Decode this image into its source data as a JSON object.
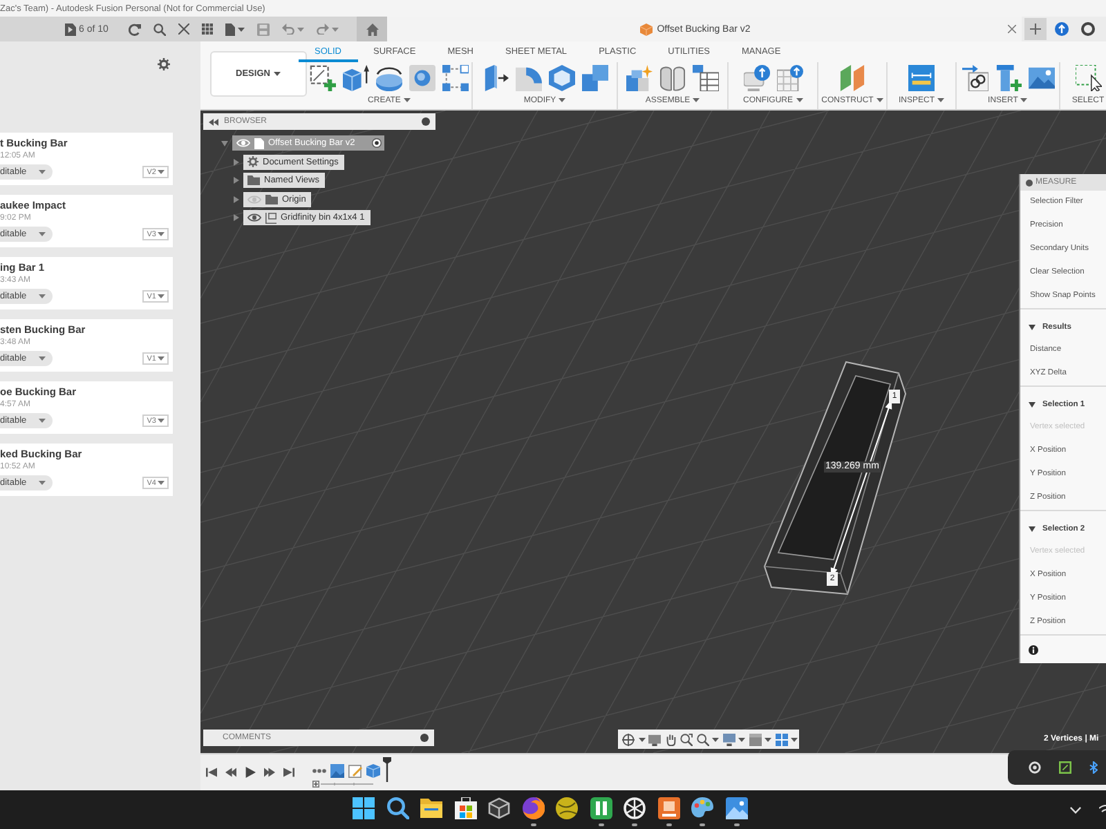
{
  "title_bar": {
    "title": "Zac's Team) - Autodesk Fusion Personal (Not for Commercial Use)"
  },
  "quick_toolbar": {
    "counter": "6 of 10"
  },
  "document_tabs": [
    {
      "label": "Offset Bucking Bar v2",
      "selected": true
    }
  ],
  "data_panel": {
    "files": [
      {
        "name": "t Bucking Bar",
        "time": "12:05 AM",
        "access": "ditable",
        "version": "V2"
      },
      {
        "name": "aukee Impact",
        "time": "9:02 PM",
        "access": "ditable",
        "version": "V3"
      },
      {
        "name": "ing Bar 1",
        "time": "3:43 AM",
        "access": "ditable",
        "version": "V1"
      },
      {
        "name": "sten Bucking Bar",
        "time": "3:48 AM",
        "access": "ditable",
        "version": "V1"
      },
      {
        "name": "oe Bucking Bar",
        "time": "4:57 AM",
        "access": "ditable",
        "version": "V3"
      },
      {
        "name": "ked Bucking Bar",
        "time": "10:52 AM",
        "access": "ditable",
        "version": "V4"
      }
    ]
  },
  "toolbar": {
    "workspace": "DESIGN",
    "tabs": [
      {
        "label": "SOLID",
        "selected": true
      },
      {
        "label": "SURFACE",
        "selected": false
      },
      {
        "label": "MESH",
        "selected": false
      },
      {
        "label": "SHEET METAL",
        "selected": false
      },
      {
        "label": "PLASTIC",
        "selected": false
      },
      {
        "label": "UTILITIES",
        "selected": false
      },
      {
        "label": "MANAGE",
        "selected": false
      }
    ],
    "groups": [
      {
        "label": "CREATE",
        "dropdown": true
      },
      {
        "label": "MODIFY",
        "dropdown": true
      },
      {
        "label": "ASSEMBLE",
        "dropdown": true
      },
      {
        "label": "CONFIGURE",
        "dropdown": true
      },
      {
        "label": "CONSTRUCT",
        "dropdown": true
      },
      {
        "label": "INSPECT",
        "dropdown": true
      },
      {
        "label": "INSERT",
        "dropdown": true
      },
      {
        "label": "SELECT",
        "dropdown": false
      }
    ]
  },
  "browser": {
    "title": "BROWSER",
    "tree": [
      {
        "label": "Offset Bucking Bar v2",
        "kind": "document",
        "selected": true,
        "expanded": true,
        "visible": true,
        "children": [
          {
            "label": "Document Settings",
            "kind": "settings",
            "selected": false,
            "expanded": false
          },
          {
            "label": "Named Views",
            "kind": "folder",
            "selected": false,
            "expanded": false
          },
          {
            "label": "Origin",
            "kind": "folder",
            "selected": false,
            "expanded": false,
            "visible": false
          },
          {
            "label": "Gridfinity bin 4x1x4 1",
            "kind": "component",
            "selected": false,
            "expanded": false,
            "visible": true
          }
        ]
      }
    ]
  },
  "measurement": {
    "value": "139.269 mm",
    "points": [
      {
        "label": "1"
      },
      {
        "label": "2"
      }
    ]
  },
  "measure_panel": {
    "title": "MEASURE",
    "options": [
      "Selection Filter",
      "Precision",
      "Secondary Units",
      "Clear Selection",
      "Show Snap Points"
    ],
    "sections": [
      {
        "title": "Results",
        "expanded": true,
        "rows": [
          {
            "label": "Distance",
            "kind": "field"
          },
          {
            "label": "XYZ Delta",
            "kind": "field"
          }
        ]
      },
      {
        "title": "Selection 1",
        "expanded": true,
        "rows": [
          {
            "label": "Vertex selected",
            "kind": "status"
          },
          {
            "label": "X Position",
            "kind": "field"
          },
          {
            "label": "Y Position",
            "kind": "field"
          },
          {
            "label": "Z Position",
            "kind": "field"
          }
        ]
      },
      {
        "title": "Selection 2",
        "expanded": true,
        "rows": [
          {
            "label": "Vertex selected",
            "kind": "status"
          },
          {
            "label": "X Position",
            "kind": "field"
          },
          {
            "label": "Y Position",
            "kind": "field"
          },
          {
            "label": "Z Position",
            "kind": "field"
          }
        ]
      }
    ]
  },
  "comments": {
    "title": "COMMENTS"
  },
  "status_text": "2 Vertices | Mi",
  "taskbar": {
    "apps": [
      {
        "kind": "start",
        "running": false
      },
      {
        "kind": "search",
        "running": false
      },
      {
        "kind": "files",
        "running": false
      },
      {
        "kind": "store",
        "running": false
      },
      {
        "kind": "cube",
        "running": false
      },
      {
        "kind": "browser",
        "running": true
      },
      {
        "kind": "ball",
        "running": false
      },
      {
        "kind": "tiles",
        "running": true
      },
      {
        "kind": "knot",
        "running": true
      },
      {
        "kind": "fusion",
        "running": true
      },
      {
        "kind": "paint",
        "running": true
      },
      {
        "kind": "photos",
        "running": true
      }
    ]
  }
}
